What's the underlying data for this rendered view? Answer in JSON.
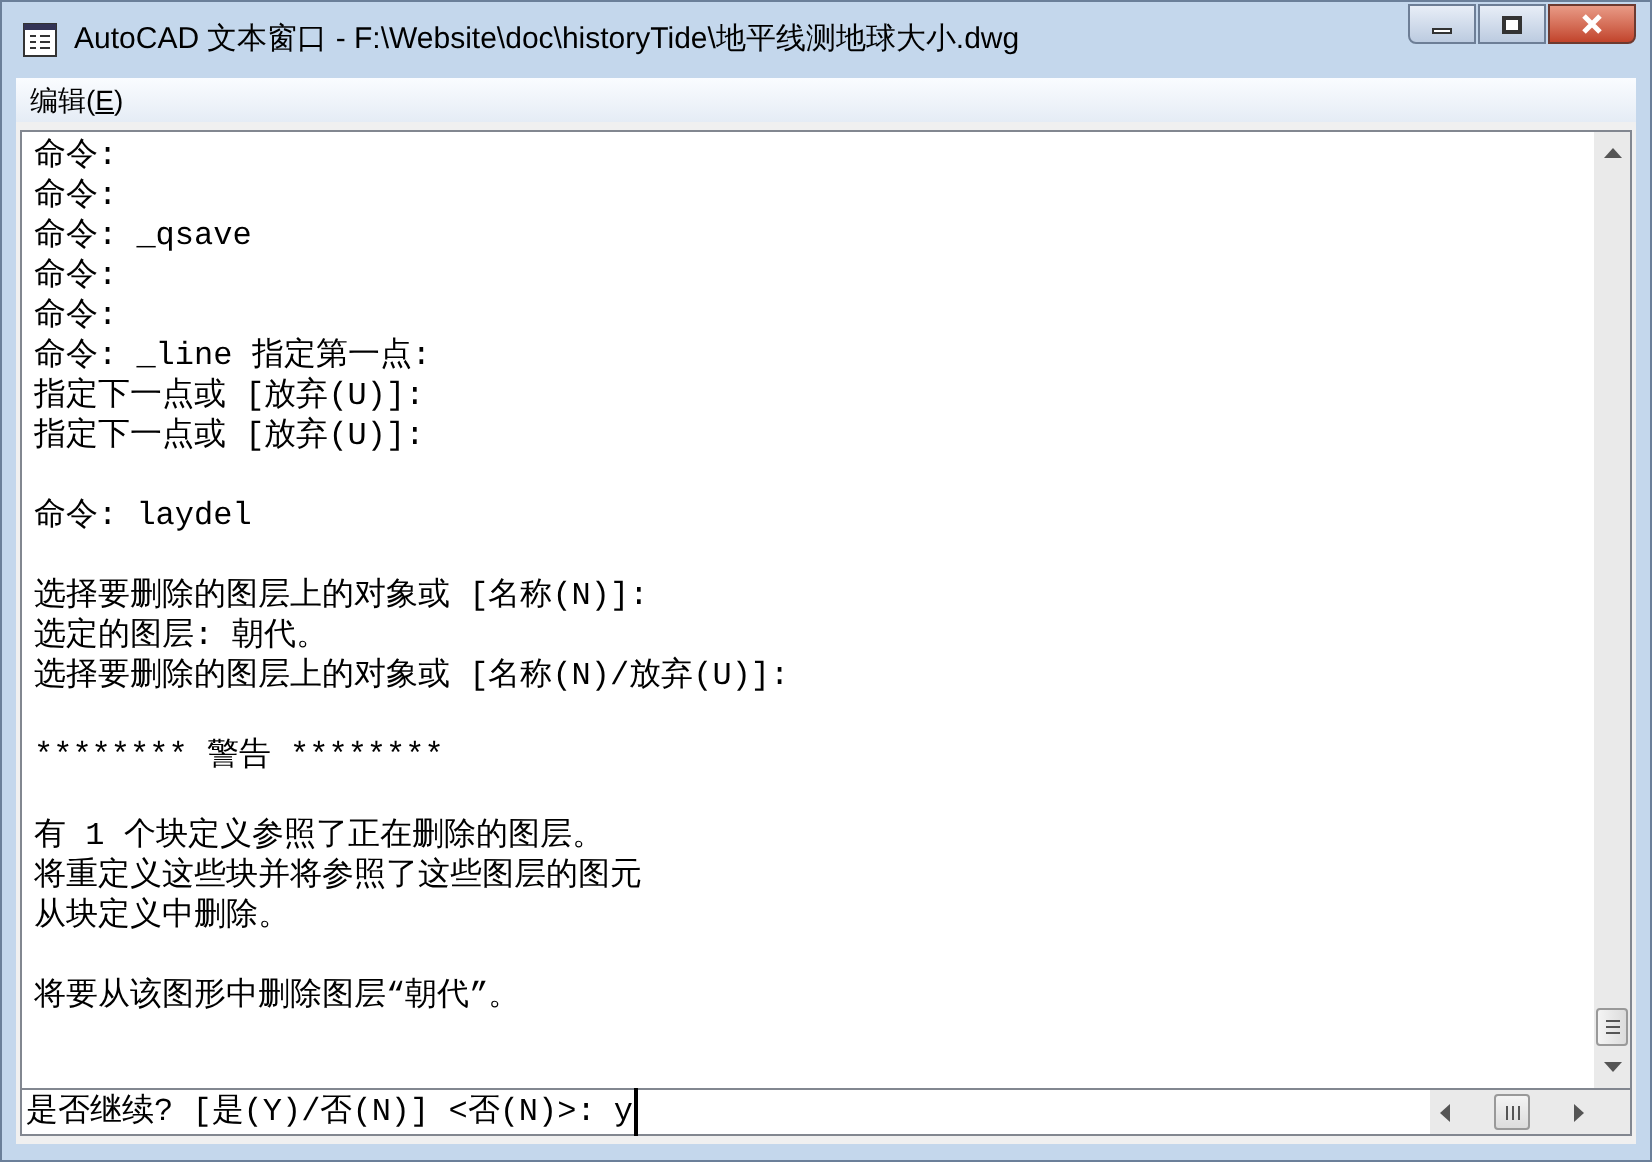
{
  "window": {
    "title": "AutoCAD 文本窗口 - F:\\Website\\doc\\historyTide\\地平线测地球大小.dwg"
  },
  "menu": [
    {
      "label": "编辑(",
      "mnemonic": "E",
      "tail": ")"
    }
  ],
  "history": [
    [
      "命令:",
      "命令:",
      "命令: _qsave",
      "命令:",
      "命令:",
      "命令: _line 指定第一点:",
      "指定下一点或 [放弃(U)]:",
      "指定下一点或 [放弃(U)]:"
    ],
    [
      "命令: laydel"
    ],
    [
      "选择要删除的图层上的对象或 [名称(N)]:",
      "选定的图层: 朝代。",
      "选择要删除的图层上的对象或 [名称(N)/放弃(U)]:"
    ],
    [
      "******** 警告 ********"
    ],
    [
      "有 1 个块定义参照了正在删除的图层。",
      "将重定义这些块并将参照了这些图层的图元",
      "从块定义中删除。"
    ],
    [
      "将要从该图形中删除图层“朝代”。"
    ]
  ],
  "command_line": {
    "prompt": "是否继续? [是(Y)/否(N)] <否(N)>:",
    "value": "y"
  }
}
